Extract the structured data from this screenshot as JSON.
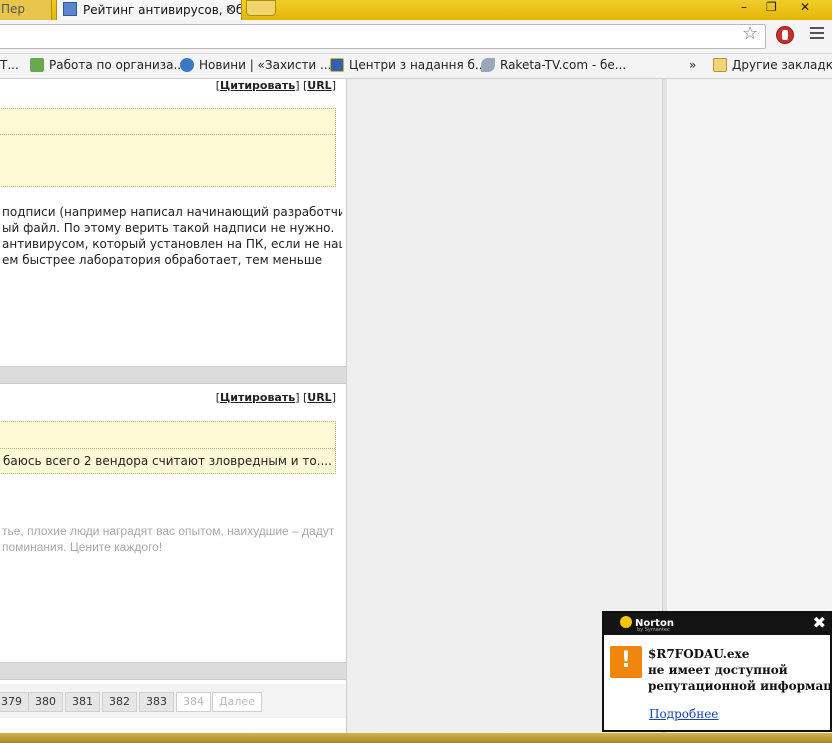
{
  "tabs": {
    "prev_label": "Пер",
    "active_label": "Рейтинг антивирусов, Об",
    "close_glyph": "×"
  },
  "window": {
    "minimize": "–",
    "maximize": "❐",
    "close": "✕"
  },
  "bookmarks": {
    "items": [
      {
        "label": "Т..."
      },
      {
        "label": "Работа по организа..."
      },
      {
        "label": "Новини | «Захисти ..."
      },
      {
        "label": "Центри з надання б..."
      },
      {
        "label": "Raketa-TV.com - бе..."
      }
    ],
    "overflow": "»",
    "other_folder": "Другие закладки"
  },
  "post1": {
    "quote_link": "Цитировать",
    "url_link": "URL",
    "lines": [
      "подписи (например написал начинающий разработчик) -",
      "ый файл. По этому верить такой надписи не нужно.",
      "антивирусом, который установлен на ПК, если не нашел",
      "ем быстрее лаборатория обработает, тем меньше"
    ]
  },
  "post2": {
    "quote_link": "Цитировать",
    "url_link": "URL",
    "quote_text": "баюсь всего 2 вендора считают зловредным и то....",
    "signature": [
      "тье, плохие люди наградят вас опытом, наихудшие – дадут",
      "поминания. Цените каждого!"
    ]
  },
  "pager": {
    "pages": [
      "379",
      "380",
      "381",
      "382",
      "383"
    ],
    "current": "384",
    "next": "Далее"
  },
  "norton": {
    "brand": "Norton",
    "by": "by Symantec",
    "close": "✖",
    "warning_glyph": "!",
    "filename": "$R7FODAU.exe",
    "line2": "не имеет доступной",
    "line3": "репутационной информации.",
    "more_link": "Подробнее"
  },
  "colors": {
    "tabstrip": "#f2cc2c",
    "quote_bg": "#fdf9d5",
    "norton_accent": "#f0860b",
    "link_blue": "#1a44a8"
  }
}
